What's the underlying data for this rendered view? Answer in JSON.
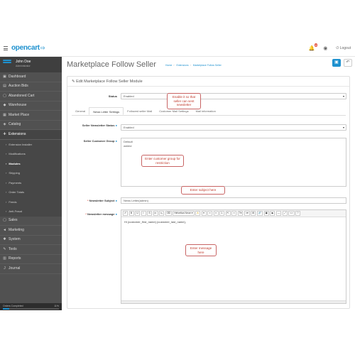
{
  "header": {
    "logo_text": "opencart",
    "logo_cart": "⇨",
    "badge": "8",
    "logout": "Logout"
  },
  "sidebar": {
    "user_name": "John Doe",
    "user_role": "Administrator",
    "items": [
      {
        "label": "Dashboard",
        "icon": "dashboard-icon",
        "glyph": "▣"
      },
      {
        "label": "Auction Bids",
        "icon": "gavel-icon",
        "glyph": "▤"
      },
      {
        "label": "Abandoned Cart",
        "icon": "cart-icon",
        "glyph": "▢"
      },
      {
        "label": "Warehouse",
        "icon": "warehouse-icon",
        "glyph": "◆"
      },
      {
        "label": "Market Place",
        "icon": "store-icon",
        "glyph": "▦"
      },
      {
        "label": "Catalog",
        "icon": "tag-icon",
        "glyph": "◈"
      },
      {
        "label": "Extensions",
        "icon": "puzzle-icon",
        "glyph": "✚"
      }
    ],
    "sub_items": [
      {
        "label": "Extension Installer"
      },
      {
        "label": "Modifications"
      },
      {
        "label": "Modules"
      },
      {
        "label": "Shipping"
      },
      {
        "label": "Payments"
      },
      {
        "label": "Order Totals"
      },
      {
        "label": "Feeds"
      },
      {
        "label": "Anti-Fraud"
      }
    ],
    "bottom_items": [
      {
        "label": "Sales",
        "icon": "cart-icon",
        "glyph": "▢"
      },
      {
        "label": "Marketing",
        "icon": "share-icon",
        "glyph": "◄"
      },
      {
        "label": "System",
        "icon": "cog-icon",
        "glyph": "✱"
      },
      {
        "label": "Tools",
        "icon": "wrench-icon",
        "glyph": "✎"
      },
      {
        "label": "Reports",
        "icon": "bar-chart-icon",
        "glyph": "▥"
      },
      {
        "label": "Journal",
        "icon": "journal-icon",
        "glyph": "J"
      }
    ],
    "orders_label": "Orders Completed",
    "orders_pct": "11%",
    "orders_fraction": 0.11
  },
  "page": {
    "title": "Marketplace Follow Seller",
    "breadcrumb": [
      "Home",
      "Extensions",
      "Marketplace Follow Seller"
    ],
    "panel_title": "✎ Edit Marketplace Follow Seller Module"
  },
  "form": {
    "status_label": "Status",
    "status_value": "Enabled",
    "tabs": [
      "General",
      "News Letter Settings",
      "Followed seller Mail",
      "Customer Mail Settings",
      "Mail information"
    ],
    "nl_status_label": "Seller Newsletter Status",
    "nl_status_value": "Enabled",
    "cust_group_label": "Seller Customer Group",
    "cust_groups": [
      "Default",
      "wekfol"
    ],
    "subject_label": "Newsletter Subject",
    "subject_value": "News Letter(admin)",
    "message_label": "Newsletter message",
    "message_value": "Hi {customer_first_name} {customer_last_name},",
    "toolbar": [
      "✐",
      "B",
      "U",
      "I",
      "S",
      "x²",
      "x₂",
      "⌫",
      "Helvetica Neue ▾",
      "A",
      "▾",
      "≡",
      "≡",
      "1.",
      "⇱",
      "≡",
      "T▾",
      "≡▾",
      "⊞",
      "🔗",
      "▣",
      "▶",
      "—",
      "⤢",
      "<>",
      "?"
    ]
  },
  "callouts": {
    "c1": "Enable it so that seller can sent newsletter",
    "c2": "Enter customer group for restriction",
    "c3": "Enter subject here",
    "c4": "Enter message here"
  }
}
